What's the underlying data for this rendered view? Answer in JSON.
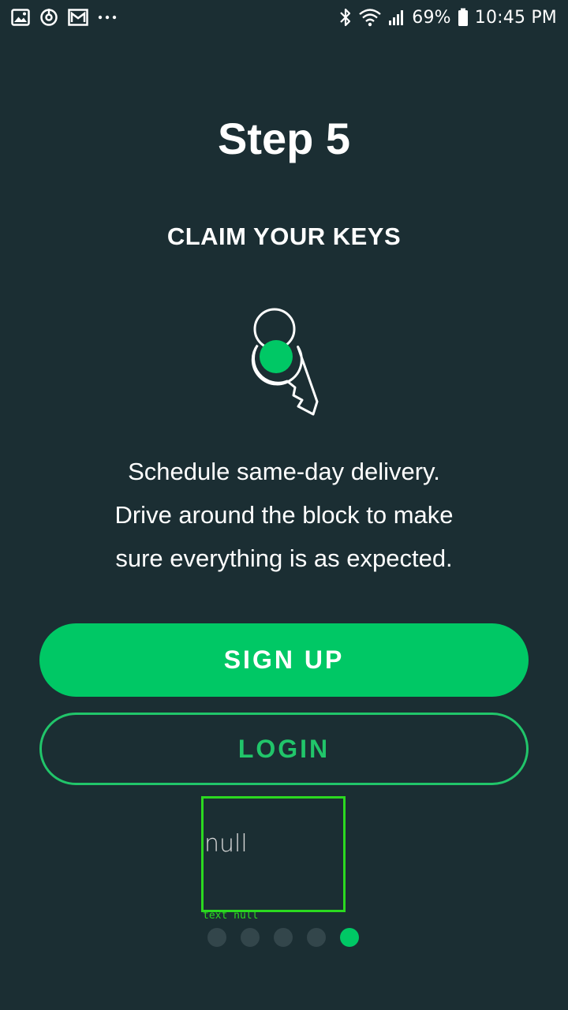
{
  "status_bar": {
    "left_icons": [
      "gallery-icon",
      "sync-icon",
      "gmail-icon",
      "more-dots-icon"
    ],
    "right_icons": [
      "bluetooth-icon",
      "wifi-icon",
      "signal-icon",
      "battery-icon"
    ],
    "battery": "69%",
    "time": "10:45 PM"
  },
  "onboarding": {
    "title": "Step 5",
    "subtitle": "CLAIM YOUR KEYS",
    "illustration": "key-icon",
    "description_lines": [
      "Schedule same-day delivery.",
      "Drive around the block to make",
      "sure everything is as expected."
    ]
  },
  "actions": {
    "signup_label": "SIGN UP",
    "login_label": "LOGIN"
  },
  "placeholder": {
    "text": "null",
    "caption": "text null"
  },
  "pager": {
    "total": 5,
    "active_index": 4
  },
  "colors": {
    "background": "#1b2e33",
    "accent": "#00c865",
    "dot_inactive": "#33464b",
    "debug_outline": "#2bd920"
  }
}
